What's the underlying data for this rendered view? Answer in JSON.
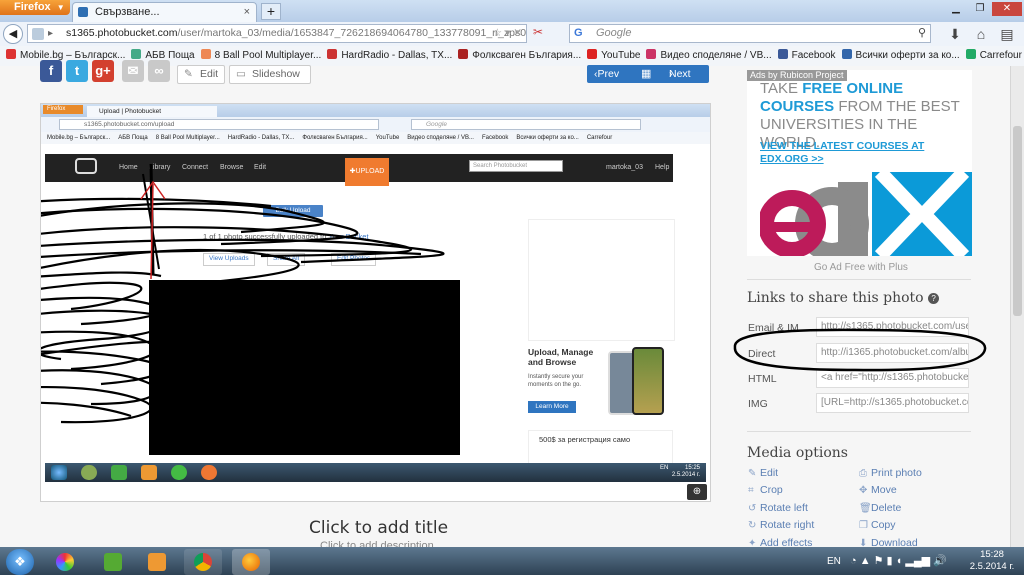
{
  "browser": {
    "app_button": "Firefox",
    "tab_title": "Свързване...",
    "url_host": "s1365.photobucket.com",
    "url_path": "/user/martoka_03/media/1653847_726218694064780_133778091_n_zps0f37279b.jpg",
    "search_placeholder": "Google",
    "bookmarks": [
      {
        "label": "Mobile.bg – Българск...",
        "color": "#d33"
      },
      {
        "label": "АБВ Поща",
        "color": "#4a8"
      },
      {
        "label": "8 Ball Pool Multiplayer...",
        "color": "#e85"
      },
      {
        "label": "HardRadio - Dallas, TX...",
        "color": "#c33"
      },
      {
        "label": "Фолксваген България...",
        "color": "#a22"
      },
      {
        "label": "YouTube",
        "color": "#d22"
      },
      {
        "label": "Видео споделяне / VB...",
        "color": "#c36"
      },
      {
        "label": "Facebook",
        "color": "#3b5998"
      },
      {
        "label": "Всички оферти за ко...",
        "color": "#36a"
      },
      {
        "label": "Carrefour",
        "color": "#2a6"
      }
    ]
  },
  "page": {
    "edit_label": "Edit",
    "slideshow_label": "Slideshow",
    "prev_label": "Prev",
    "next_label": "Next",
    "click_title": "Click to add title",
    "click_desc": "Click to add description"
  },
  "inner": {
    "app_button": "Firefox",
    "tab_title": "Upload | Photobucket",
    "url": "s1365.photobucket.com/upload",
    "search_placeholder": "Google",
    "bookmarks": [
      "Mobile.bg – Българск...",
      "АБВ Поща",
      "8 Ball Pool Multiplayer...",
      "HardRadio - Dallas, TX...",
      "Фолксваген България...",
      "YouTube",
      "Видео споделяне / VB...",
      "Facebook",
      "Всички оферти за ко...",
      "Carrefour"
    ],
    "menu": [
      "Home",
      "Library",
      "Connect",
      "Browse",
      "Edit"
    ],
    "upload": "UPLOAD",
    "search": "Search Photobucket",
    "user": "martoka_03",
    "help": "Help",
    "bulk_upload": "Bulk Upload",
    "success_prefix": "1 of 1 photo successfully uploaded to",
    "success_link": "Your Bucket",
    "view_uploads": "View Uploads",
    "share_all": "Share All",
    "edit_photos": "Edit Photos",
    "ad_title": "Upload, Manage and Browse",
    "ad_sub": "Instantly secure your moments on the go.",
    "learn_more": "Learn More",
    "ad2_text": "500$ за регистрация само",
    "tray_lang": "EN",
    "tray_time": "15:25",
    "tray_date": "2.5.2014 г."
  },
  "sidebar": {
    "ad_label": "Ads by Rubicon Project",
    "ad_line1": "TAKE",
    "ad_highlight": "FREE ONLINE COURSES",
    "ad_line2": "FROM THE BEST UNIVERSITIES IN THE WORLD.",
    "ad_cta": "VIEW THE LATEST COURSES AT EDX.ORG >>",
    "ad_free": "Go Ad Free with Plus",
    "links_title": "Links to share this photo",
    "links": [
      {
        "label": "Email & IM",
        "value": "http://s1365.photobucket.com/user/"
      },
      {
        "label": "Direct",
        "value": "http://i1365.photobucket.com/albu"
      },
      {
        "label": "HTML",
        "value": "<a href=\"http://s1365.photobucket"
      },
      {
        "label": "IMG",
        "value": "[URL=http://s1365.photobucket.co"
      }
    ],
    "media_title": "Media options",
    "media_left": [
      {
        "label": "Edit",
        "icon": "pencil-icon"
      },
      {
        "label": "Crop",
        "icon": "crop-icon"
      },
      {
        "label": "Rotate left",
        "icon": "rotate-left-icon"
      },
      {
        "label": "Rotate right",
        "icon": "rotate-right-icon"
      },
      {
        "label": "Add effects",
        "icon": "effects-icon"
      }
    ],
    "media_right": [
      {
        "label": "Print photo",
        "icon": "print-icon"
      },
      {
        "label": "Move",
        "icon": "move-icon"
      },
      {
        "label": "Delete",
        "icon": "delete-icon"
      },
      {
        "label": "Copy",
        "icon": "copy-icon"
      },
      {
        "label": "Download",
        "icon": "download-icon"
      }
    ]
  },
  "taskbar": {
    "lang": "EN",
    "time": "15:28",
    "date": "2.5.2014 г."
  }
}
